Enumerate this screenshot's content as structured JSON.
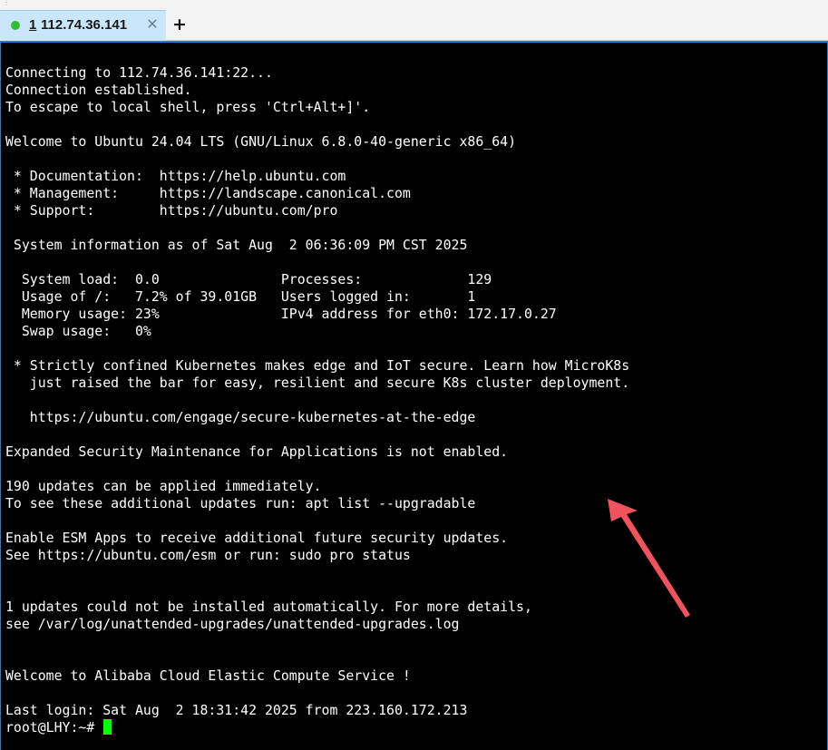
{
  "tabs": [
    {
      "number": "1",
      "title": "112.74.36.141",
      "status": "connected",
      "status_color": "#2fbf2f",
      "active": true
    }
  ],
  "tab_controls": {
    "close_glyph": "✕",
    "new_tab_glyph": "+"
  },
  "terminal": {
    "lines": [
      "Connecting to 112.74.36.141:22...",
      "Connection established.",
      "To escape to local shell, press 'Ctrl+Alt+]'.",
      "",
      "Welcome to Ubuntu 24.04 LTS (GNU/Linux 6.8.0-40-generic x86_64)",
      "",
      " * Documentation:  https://help.ubuntu.com",
      " * Management:     https://landscape.canonical.com",
      " * Support:        https://ubuntu.com/pro",
      "",
      " System information as of Sat Aug  2 06:36:09 PM CST 2025",
      "",
      "  System load:  0.0               Processes:             129",
      "  Usage of /:   7.2% of 39.01GB   Users logged in:       1",
      "  Memory usage: 23%               IPv4 address for eth0: 172.17.0.27",
      "  Swap usage:   0%",
      "",
      " * Strictly confined Kubernetes makes edge and IoT secure. Learn how MicroK8s",
      "   just raised the bar for easy, resilient and secure K8s cluster deployment.",
      "",
      "   https://ubuntu.com/engage/secure-kubernetes-at-the-edge",
      "",
      "Expanded Security Maintenance for Applications is not enabled.",
      "",
      "190 updates can be applied immediately.",
      "To see these additional updates run: apt list --upgradable",
      "",
      "Enable ESM Apps to receive additional future security updates.",
      "See https://ubuntu.com/esm or run: sudo pro status",
      "",
      "",
      "1 updates could not be installed automatically. For more details,",
      "see /var/log/unattended-upgrades/unattended-upgrades.log",
      "",
      "",
      "Welcome to Alibaba Cloud Elastic Compute Service !",
      "",
      "Last login: Sat Aug  2 18:31:42 2025 from 223.160.172.213"
    ],
    "prompt": "root@LHY:~# ",
    "cursor_color": "#00ff00",
    "background": "#000000",
    "foreground": "#ffffff"
  },
  "annotation": {
    "arrow_color": "#f0535d"
  }
}
